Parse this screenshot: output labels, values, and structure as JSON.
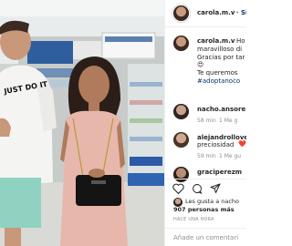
{
  "post": {
    "username": "carola.m.v",
    "dot": "•",
    "follow_label": "Si",
    "caption_lines": [
      "Ho",
      "maravilloso di",
      "Gracias por tar"
    ],
    "caption_emoji": "😍",
    "caption_line4": "Te queremos",
    "hashtag": "#adoptanoco",
    "time_label": "HACE UNA HORA",
    "likes_line1": "Les gusta a nacho",
    "likes_line2": "907 personas más",
    "add_comment_placeholder": "Añade un comentari"
  },
  "comments": [
    {
      "user": "nacho.ansore",
      "text": "",
      "age": "58 min",
      "likes": "1 Me g"
    },
    {
      "user": "alejandrollove",
      "text": "preciosidad",
      "heart": "❤️",
      "age": "59 min",
      "likes": "1 Me gu"
    },
    {
      "user": "graciperezm",
      "text": "",
      "age": "",
      "likes": ""
    }
  ],
  "photo": {
    "shirt_text": "JUST DO IT"
  },
  "colors": {
    "accent_blue": "#00376b",
    "heart_red": "#ed4956"
  },
  "icons": [
    "more-options-icon",
    "heart-icon",
    "comment-icon",
    "share-icon",
    "bookmark-icon",
    "small-heart-icon"
  ]
}
